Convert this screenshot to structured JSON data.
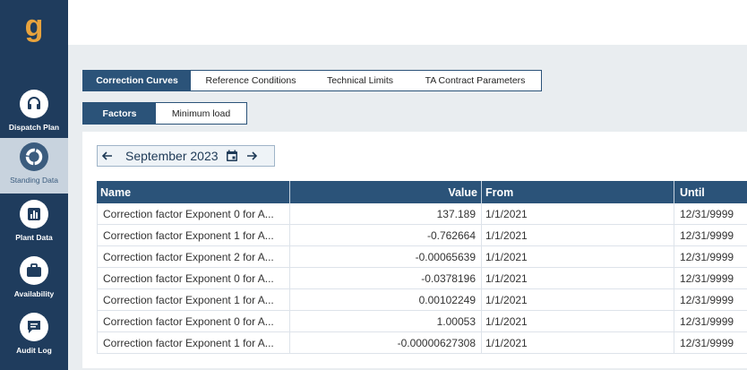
{
  "sidebar": {
    "logo_letter": "g",
    "items": [
      {
        "label": "Dispatch Plan",
        "icon": "headset-icon"
      },
      {
        "label": "Standing Data",
        "icon": "spinner-ring-icon"
      },
      {
        "label": "Plant Data",
        "icon": "bar-chart-icon"
      },
      {
        "label": "Availability",
        "icon": "briefcase-icon"
      },
      {
        "label": "Audit Log",
        "icon": "chat-bubble-icon"
      }
    ]
  },
  "tabs_primary": [
    {
      "label": "Correction Curves",
      "active": true
    },
    {
      "label": "Reference Conditions",
      "active": false
    },
    {
      "label": "Technical Limits",
      "active": false
    },
    {
      "label": "TA Contract Parameters",
      "active": false
    }
  ],
  "tabs_secondary": [
    {
      "label": "Factors",
      "active": true
    },
    {
      "label": "Minimum load",
      "active": false
    }
  ],
  "date_nav": {
    "month": "September 2023"
  },
  "table": {
    "columns": [
      "Name",
      "Value",
      "From",
      "Until"
    ],
    "rows": [
      {
        "name": "Correction factor Exponent 0 for A...",
        "value": "137.189",
        "from": "1/1/2021",
        "until": "12/31/9999"
      },
      {
        "name": "Correction factor Exponent 1 for A...",
        "value": "-0.762664",
        "from": "1/1/2021",
        "until": "12/31/9999"
      },
      {
        "name": "Correction factor Exponent 2 for A...",
        "value": "-0.00065639",
        "from": "1/1/2021",
        "until": "12/31/9999"
      },
      {
        "name": "Correction factor Exponent 0 for A...",
        "value": "-0.0378196",
        "from": "1/1/2021",
        "until": "12/31/9999"
      },
      {
        "name": "Correction factor Exponent 1 for A...",
        "value": "0.00102249",
        "from": "1/1/2021",
        "until": "12/31/9999"
      },
      {
        "name": "Correction factor Exponent 0 for A...",
        "value": "1.00053",
        "from": "1/1/2021",
        "until": "12/31/9999"
      },
      {
        "name": "Correction factor Exponent 1 for A...",
        "value": "-0.00000627308",
        "from": "1/1/2021",
        "until": "12/31/9999"
      }
    ]
  },
  "colors": {
    "sidebar": "#1f3c5d",
    "accent": "#2b5379",
    "logo": "#e8a33d"
  }
}
